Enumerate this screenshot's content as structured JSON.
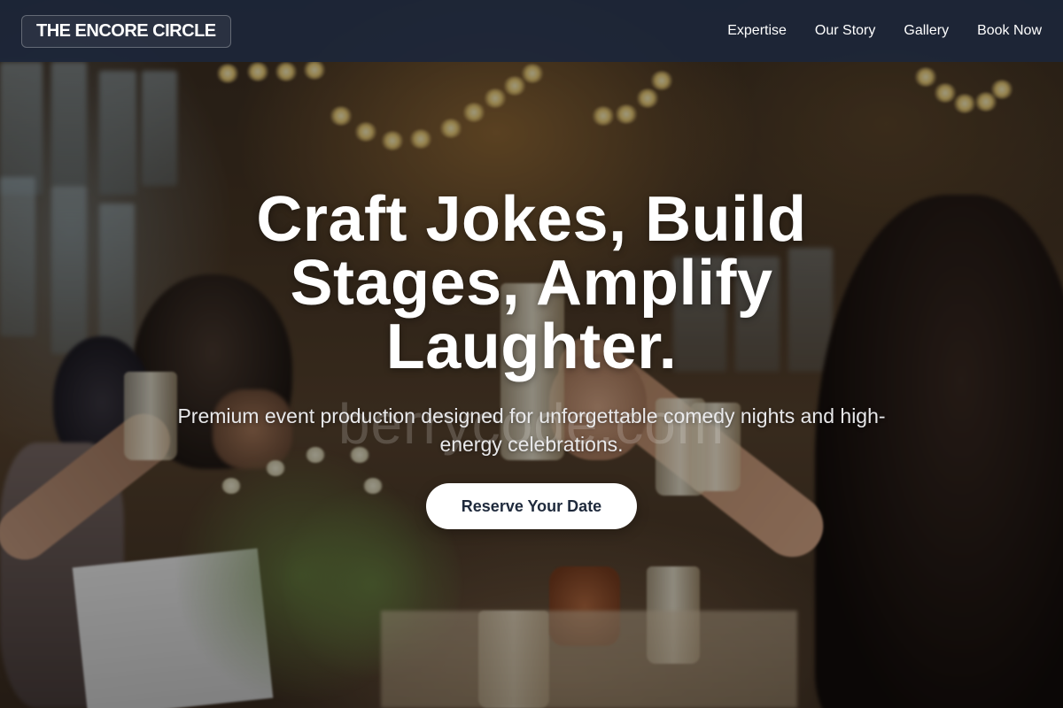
{
  "header": {
    "logo_text": "THE ENCORE CIRCLE",
    "nav": [
      {
        "label": "Expertise"
      },
      {
        "label": "Our Story"
      },
      {
        "label": "Gallery"
      },
      {
        "label": "Book Now"
      }
    ]
  },
  "hero": {
    "headline": "Craft Jokes, Build Stages, Amplify Laughter.",
    "subtitle": "Premium event production designed for unforgettable comedy nights and high-energy celebrations.",
    "cta_label": "Reserve Your Date",
    "watermark": "berrycode.com",
    "background_description_icon": "banquet-toast-photo"
  },
  "colors": {
    "header_bg": "#1c263a",
    "button_bg": "#ffffff",
    "button_text": "#1f2a3c",
    "text_primary": "#ffffff"
  }
}
